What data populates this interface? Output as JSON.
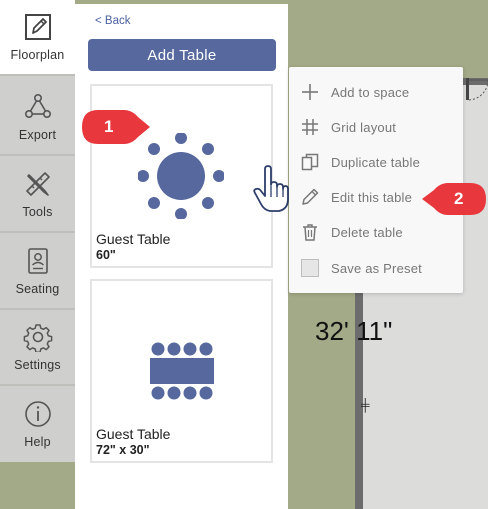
{
  "canvas": {
    "dimension_label": "32' 11\""
  },
  "rail": {
    "items": [
      {
        "label": "Floorplan",
        "icon": "pencil-square-icon",
        "active": true
      },
      {
        "label": "Export",
        "icon": "share-nodes-icon",
        "active": false
      },
      {
        "label": "Tools",
        "icon": "pencil-ruler-icon",
        "active": false
      },
      {
        "label": "Seating",
        "icon": "seating-chart-icon",
        "active": false
      },
      {
        "label": "Settings",
        "icon": "gear-icon",
        "active": false
      },
      {
        "label": "Help",
        "icon": "info-icon",
        "active": false
      }
    ]
  },
  "panel": {
    "back_label": "< Back",
    "add_table_label": "Add Table",
    "tables": [
      {
        "name": "Guest Table",
        "size": "60\"",
        "shape": "round"
      },
      {
        "name": "Guest Table",
        "size": "72\" x 30\"",
        "shape": "rectangle"
      }
    ]
  },
  "context_menu": {
    "items": [
      {
        "label": "Add to space",
        "icon": "plus-icon"
      },
      {
        "label": "Grid layout",
        "icon": "hash-icon"
      },
      {
        "label": "Duplicate table",
        "icon": "duplicate-icon"
      },
      {
        "label": "Edit this table",
        "icon": "pencil-icon"
      },
      {
        "label": "Delete table",
        "icon": "trash-icon"
      },
      {
        "label": "Save as Preset",
        "icon": "checkbox-icon"
      }
    ]
  },
  "callouts": {
    "first": "1",
    "second": "2"
  },
  "colors": {
    "accent": "#56689e",
    "callout": "#e8383d",
    "canvas": "#a3aa87",
    "rail": "#cfd0cd"
  }
}
